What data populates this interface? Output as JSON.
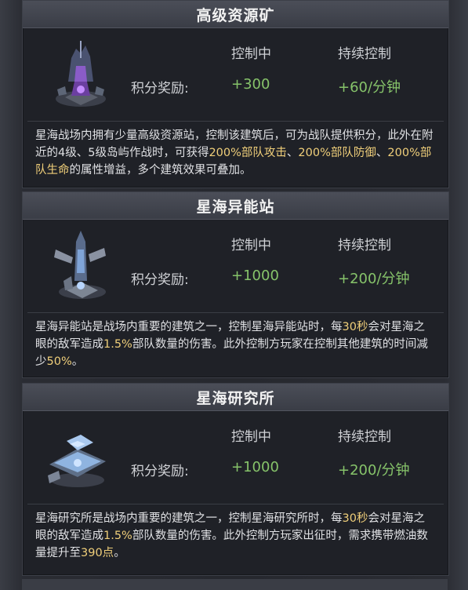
{
  "panels": [
    {
      "title": "高级资源矿",
      "col_control": "控制中",
      "col_sustain": "持续控制",
      "reward_label": "积分奖励:",
      "reward_control": "+300",
      "reward_sustain": "+60/分钟",
      "desc_parts": [
        {
          "t": "星海战场内拥有少量高级资源站，控制该建筑后，可为战队提供积分，此外在附近的4级、5级岛屿作战时，可获得",
          "hl": false
        },
        {
          "t": "200%部队攻击",
          "hl": true
        },
        {
          "t": "、",
          "hl": false
        },
        {
          "t": "200%部队防御",
          "hl": true
        },
        {
          "t": "、",
          "hl": false
        },
        {
          "t": "200%部队生命",
          "hl": true
        },
        {
          "t": "的属性增益，多个建筑效果可叠加。",
          "hl": false
        }
      ]
    },
    {
      "title": "星海异能站",
      "col_control": "控制中",
      "col_sustain": "持续控制",
      "reward_label": "积分奖励:",
      "reward_control": "+1000",
      "reward_sustain": "+200/分钟",
      "desc_parts": [
        {
          "t": "星海异能站是战场内重要的建筑之一，控制星海异能站时，每",
          "hl": false
        },
        {
          "t": "30秒",
          "hl": true
        },
        {
          "t": "会对星海之眼的敌军造成",
          "hl": false
        },
        {
          "t": "1.5%",
          "hl": true
        },
        {
          "t": "部队数量的伤害。此外控制方玩家在控制其他建筑的时间减少",
          "hl": false
        },
        {
          "t": "50%",
          "hl": true
        },
        {
          "t": "。",
          "hl": false
        }
      ]
    },
    {
      "title": "星海研究所",
      "col_control": "控制中",
      "col_sustain": "持续控制",
      "reward_label": "积分奖励:",
      "reward_control": "+1000",
      "reward_sustain": "+200/分钟",
      "desc_parts": [
        {
          "t": "星海研究所是战场内重要的建筑之一，控制星海研究所时，每",
          "hl": false
        },
        {
          "t": "30秒",
          "hl": true
        },
        {
          "t": "会对星海之眼的敌军造成",
          "hl": false
        },
        {
          "t": "1.5%",
          "hl": true
        },
        {
          "t": "部队数量的伤害。此外控制方玩家出征时，需求携带燃油数量提升至",
          "hl": false
        },
        {
          "t": "390点",
          "hl": true
        },
        {
          "t": "。",
          "hl": false
        }
      ]
    }
  ],
  "colors": {
    "value_green": "#86c36a",
    "highlight_gold": "#f0cf7a"
  },
  "icons": [
    "resource-mine-building-icon",
    "psionic-station-building-icon",
    "research-institute-building-icon"
  ]
}
